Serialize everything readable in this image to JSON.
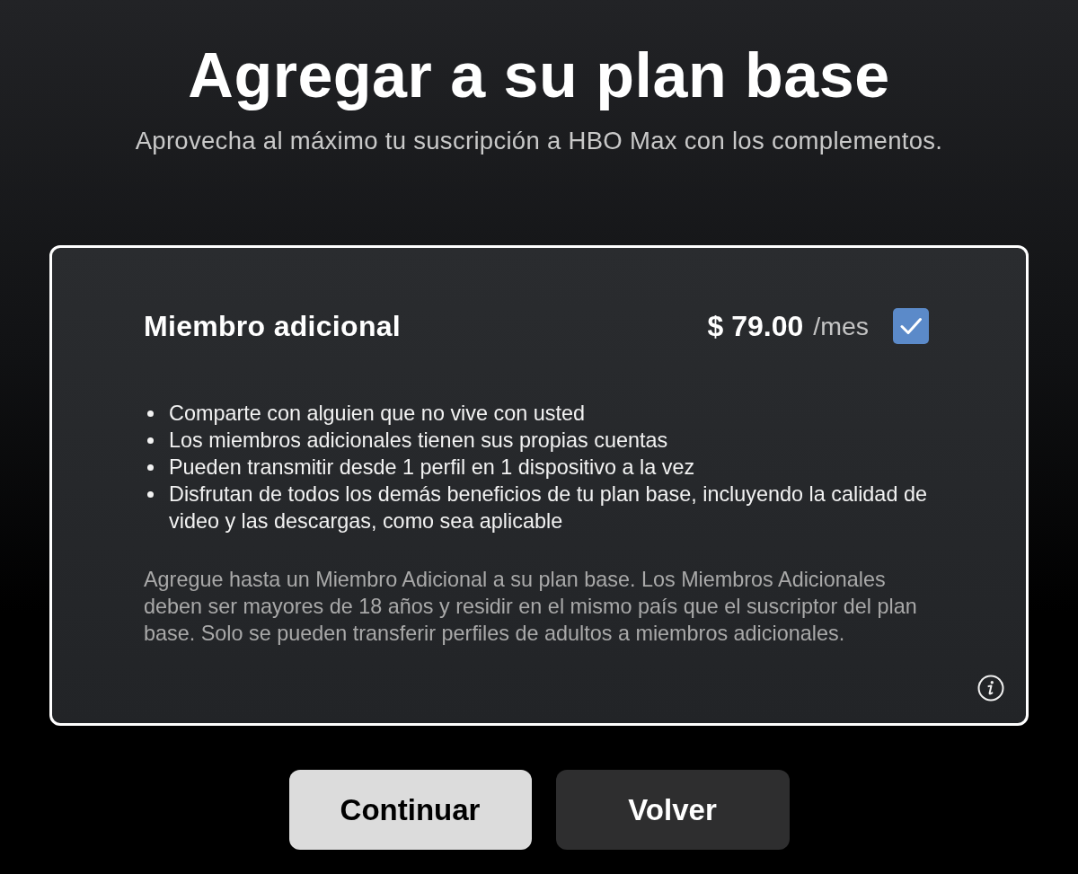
{
  "header": {
    "title": "Agregar a su plan base",
    "subtitle": "Aprovecha al máximo tu suscripción a HBO Max con los complementos."
  },
  "addon": {
    "name": "Miembro adicional",
    "price": "$ 79.00",
    "period": "/mes",
    "checked": true,
    "features": [
      "Comparte con alguien que no vive con usted",
      "Los miembros adicionales tienen sus propias cuentas",
      "Pueden transmitir desde 1 perfil en 1 dispositivo a la vez",
      "Disfrutan de todos los demás beneficios de tu plan base, incluyendo la calidad de video y las descargas, como sea aplicable"
    ],
    "note": "Agregue hasta un Miembro Adicional a su plan base. Los Miembros Adicionales deben ser mayores de 18 años y residir en el mismo país que el suscriptor del plan base. Solo se pueden transferir perfiles de adultos a miembros adicionales."
  },
  "buttons": [
    {
      "label": "Continuar",
      "kind": "primary"
    },
    {
      "label": "Volver",
      "kind": "secondary"
    }
  ]
}
